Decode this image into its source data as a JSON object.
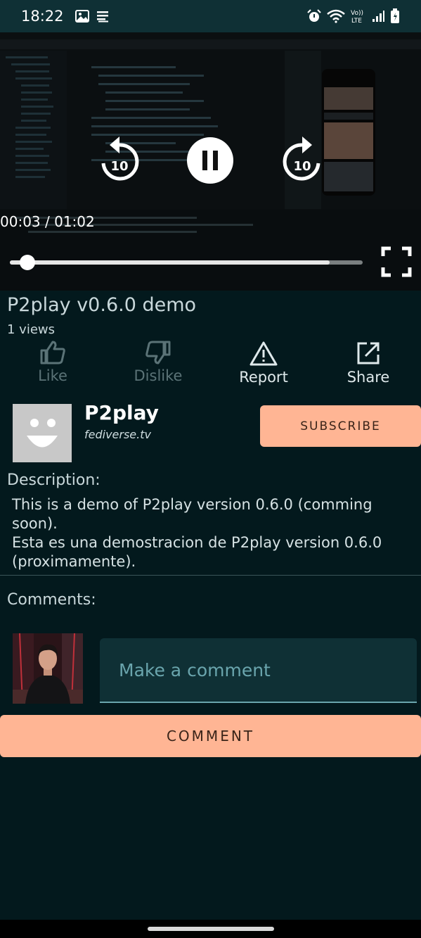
{
  "status_bar": {
    "time": "18:22",
    "left_icons": [
      "image-icon",
      "notes-icon"
    ],
    "right_icons": [
      "alarm-icon",
      "wifi-icon",
      "volte-icon",
      "signal-icon",
      "battery-icon"
    ],
    "volte_label_top": "Vo))",
    "volte_label_bottom": "LTE"
  },
  "player": {
    "rewind_seconds": "10",
    "forward_seconds": "10",
    "time_display": "00:03 / 01:02",
    "progress_fraction": 0.05,
    "buffered_fraction": 0.907
  },
  "video": {
    "title": "P2play v0.6.0 demo",
    "views": "1 views"
  },
  "actions": {
    "like": "Like",
    "dislike": "Dislike",
    "report": "Report",
    "share": "Share"
  },
  "channel": {
    "name": "P2play",
    "host": "fediverse.tv",
    "subscribe_label": "SUBSCRIBE"
  },
  "description": {
    "heading": "Description:",
    "lines": [
      "This is a demo of P2play version 0.6.0 (comming soon).",
      "Esta es una demostracion de P2play version 0.6.0 (proximamente)."
    ]
  },
  "comments": {
    "heading": "Comments:",
    "input_placeholder": "Make a comment",
    "button_label": "COMMENT"
  },
  "colors": {
    "background": "#03191d",
    "surface": "#0f3035",
    "accent": "#ffb594",
    "input_underline": "#6aa5ad"
  }
}
